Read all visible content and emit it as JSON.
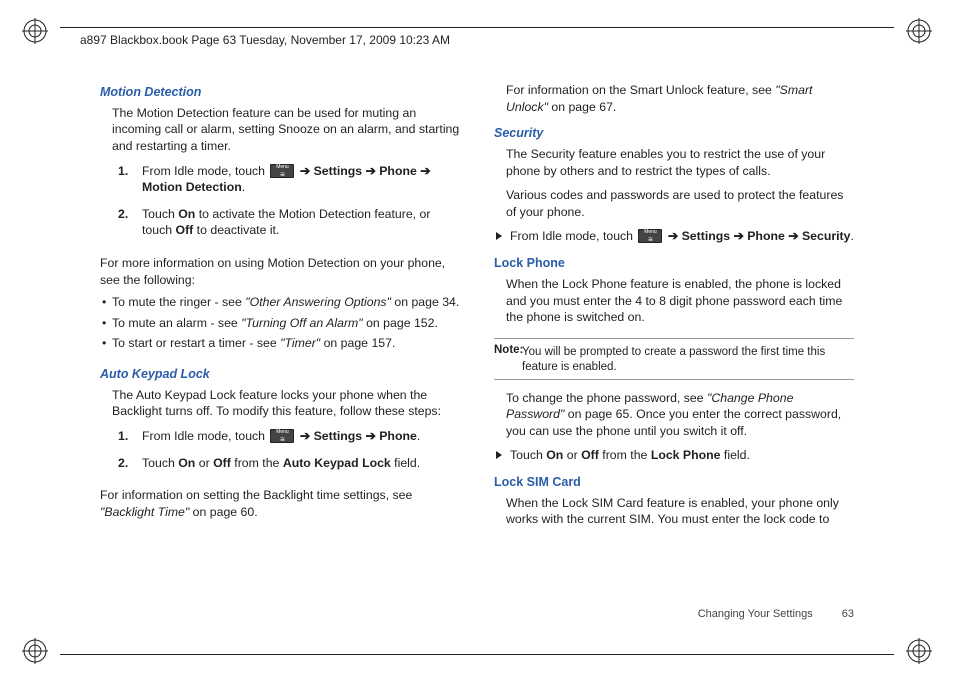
{
  "header": "a897 Blackbox.book  Page 63  Tuesday, November 17, 2009  10:23 AM",
  "footer": {
    "section": "Changing Your Settings",
    "page": "63"
  },
  "left": {
    "h_motion": "Motion Detection",
    "motion_intro": "The Motion Detection feature can be used for muting an incoming call or alarm, setting Snooze on an alarm, and starting and restarting a timer.",
    "motion_s1_a": "From Idle mode, touch ",
    "motion_s1_b": " ➔ Settings ➔ Phone ➔ Motion Detection",
    "motion_s1_c": ".",
    "motion_s2_a": "Touch ",
    "motion_s2_on": "On",
    "motion_s2_b": " to activate the Motion Detection feature, or touch ",
    "motion_s2_off": "Off",
    "motion_s2_c": " to deactivate it.",
    "motion_more": "For more information on using Motion Detection on your phone, see the following:",
    "b1_a": "To mute the ringer - see ",
    "b1_i": "\"Other Answering Options\"",
    "b1_c": " on page 34.",
    "b2_a": "To mute an alarm - see ",
    "b2_i": "\"Turning Off an Alarm\"",
    "b2_c": " on page 152.",
    "b3_a": "To start or restart a timer - see ",
    "b3_i": "\"Timer\"",
    "b3_c": " on page 157.",
    "h_auto": "Auto Keypad Lock",
    "auto_intro": "The Auto Keypad Lock feature locks your phone when the Backlight turns off. To modify this feature, follow these steps:",
    "auto_s1_a": "From Idle mode, touch ",
    "auto_s1_b": " ➔ Settings ➔ Phone",
    "auto_s1_c": ".",
    "auto_s2_a": "Touch ",
    "auto_s2_on": "On",
    "auto_s2_b": " or ",
    "auto_s2_off": "Off",
    "auto_s2_c": " from the ",
    "auto_s2_field": "Auto Keypad Lock",
    "auto_s2_d": " field.",
    "auto_more_a": "For information on setting the Backlight time settings, see ",
    "auto_more_i": "\"Backlight Time\"",
    "auto_more_c": " on page 60."
  },
  "right": {
    "smart_a": "For information on the Smart Unlock feature, see ",
    "smart_i": "\"Smart Unlock\"",
    "smart_c": " on page 67.",
    "h_security": "Security",
    "sec_p1": "The Security feature enables you to restrict the use of your phone by others and to restrict the types of calls.",
    "sec_p2": "Various codes and passwords are used to protect the features of your phone.",
    "sec_tri_a": "From Idle mode, touch ",
    "sec_tri_b": " ➔ Settings ➔ Phone  ➔ Security",
    "sec_tri_c": ".",
    "h_lockphone": "Lock Phone",
    "lp_p1": "When the Lock Phone feature is enabled, the phone is locked and you must enter the 4 to 8 digit phone password each time the phone is switched on.",
    "note_label": "Note:",
    "note_body": "You will be prompted to create a password the first time this feature is enabled.",
    "lp_p2_a": "To change the phone password, see ",
    "lp_p2_i": "\"Change Phone Password\"",
    "lp_p2_c": " on page 65. Once you enter the correct password, you can use the phone until you switch it off.",
    "lp_tri_a": "Touch ",
    "lp_tri_on": "On",
    "lp_tri_b": " or ",
    "lp_tri_off": "Off",
    "lp_tri_c": " from the ",
    "lp_tri_field": "Lock Phone",
    "lp_tri_d": " field.",
    "h_locksim": "Lock SIM Card",
    "ls_p1": "When the Lock SIM Card feature is enabled, your phone only works with the current SIM. You must enter the lock code to"
  }
}
